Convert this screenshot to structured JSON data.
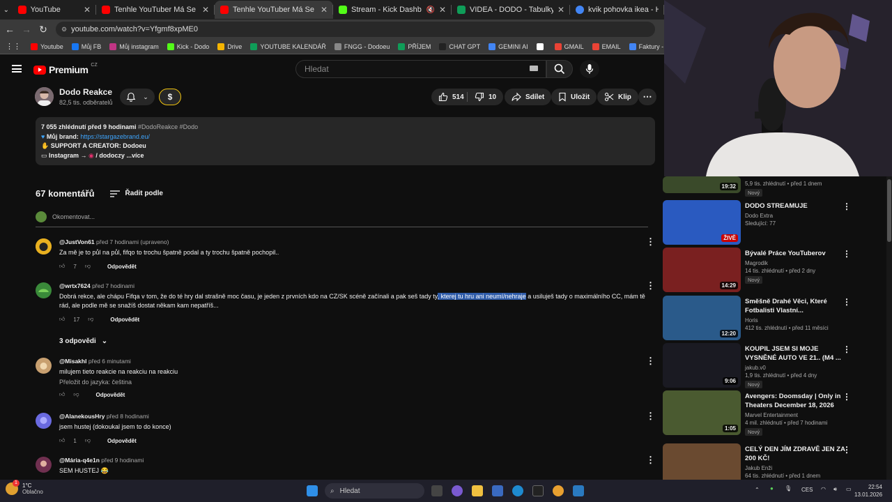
{
  "browser": {
    "tabs": [
      {
        "title": "YouTube",
        "color": "#ff0000",
        "active": false,
        "muted": false
      },
      {
        "title": "Tenhle YouTuber Má Se Mnou P...",
        "color": "#ff0000",
        "active": false,
        "muted": false
      },
      {
        "title": "Tenhle YouTuber Má Se Mnou P...",
        "color": "#ff0000",
        "active": true,
        "muted": false
      },
      {
        "title": "Stream - Kick Dashboard",
        "color": "#53fc18",
        "active": false,
        "muted": true
      },
      {
        "title": "VIDEA - DODO - Tabulky Google",
        "color": "#0f9d58",
        "active": false,
        "muted": false
      },
      {
        "title": "kvik pohovka ikea - Hledat Goog",
        "color": "#4285f4",
        "active": false,
        "muted": false
      }
    ],
    "url": "youtube.com/watch?v=Yfgmf8xpME0",
    "bookmarks": [
      {
        "label": "Youtube",
        "color": "#ff0000"
      },
      {
        "label": "Můj FB",
        "color": "#1877f2"
      },
      {
        "label": "Můj instagram",
        "color": "#c13584"
      },
      {
        "label": "Kick - Dodo",
        "color": "#53fc18"
      },
      {
        "label": "Drive",
        "color": "#f4b400"
      },
      {
        "label": "YOUTUBE KALENDÁŘ",
        "color": "#0f9d58"
      },
      {
        "label": "FNGG - Dodoeu",
        "color": "#888888"
      },
      {
        "label": "PŘÍJEM",
        "color": "#0f9d58"
      },
      {
        "label": "CHAT GPT",
        "color": "#222222"
      },
      {
        "label": "GEMINI AI",
        "color": "#4285f4"
      },
      {
        "label": "",
        "color": "#ffffff"
      },
      {
        "label": "GMAIL",
        "color": "#ea4335"
      },
      {
        "label": "EMAIL",
        "color": "#ea4335"
      },
      {
        "label": "Faktury - Vytváření",
        "color": "#4285f4"
      },
      {
        "label": "PNG to PDF",
        "color": "#e53935"
      }
    ]
  },
  "yt": {
    "logo": "Premium",
    "logo_region": "CZ",
    "search_placeholder": "Hledat"
  },
  "video": {
    "channel": "Dodo Reakce",
    "subs": "82,5 tis. odběratelů",
    "likes": "514",
    "dislikes": "10",
    "share": "Sdílet",
    "save": "Uložit",
    "clip": "Klip",
    "desc_meta": "7 055 zhlédnutí  před 9 hodinami",
    "desc_tags": "#DodoReakce #Dodo",
    "brand_label": "Můj brand: ",
    "brand_link": "https://stargazebrand.eu/",
    "support": "SUPPORT A CREATOR: Dodoeu",
    "insta": "Instagram → ",
    "insta_handle": " / dodoczy",
    "more": "...více"
  },
  "comments_section": {
    "count": "67 komentářů",
    "sort": "Řadit podle",
    "add_placeholder": "Okomentovat..."
  },
  "comments": [
    {
      "user": "@JustVon61",
      "time": "před 7 hodinami (upraveno)",
      "text": "Za mě je to půl na půl, fifqo to trochu špatně podal a ty trochu špatně pochopil..",
      "likes": "7",
      "reply": "Odpovědět",
      "color": "#e8b020"
    },
    {
      "user": "@wrtx7624",
      "time": "před 7 hodinami",
      "text_a": "Dobrá rekce, ale chápu Fifqa v tom, že do té hry dal strašně moc času, je jeden z prvních kdo na CZ/SK scéně začínali a pak seš tady ty",
      "text_hl": ", kterej tu hru ani neumí/nehraje",
      "text_b": " a usiluješ tady o maximálního CC, mám tě rád, ale podle mě se snažíš dostat někam kam nepatříš...",
      "likes": "17",
      "reply": "Odpovědět",
      "color": "#3a8a3a"
    },
    {
      "user": "@Misakhl",
      "time": "před 6 minutami",
      "text": "milujem tieto reakcie na reakciu na reakciu",
      "translate": "Přeložit do jazyka: čeština",
      "reply": "Odpovědět",
      "color": "#c8a070"
    },
    {
      "user": "@AlanekousHry",
      "time": "před 8 hodinami",
      "text": "jsem hustej (dokoukal jsem to do konce)",
      "likes": "1",
      "reply": "Odpovědět",
      "color": "#6a6ae0"
    },
    {
      "user": "@Mária-q4e1n",
      "time": "před 9 hodinami",
      "text": "SEM HUSTEJ 😂",
      "color": "#703050"
    }
  ],
  "replies_toggle": "3 odpovědi",
  "sidebar": [
    {
      "title": "",
      "channel": "",
      "stats": "5,9 tis. zhlédnutí • před 1 dnem",
      "badge": "Nový",
      "duration": "19:32",
      "thumb": "#3a4a2a"
    },
    {
      "title": "DODO STREAMUJE",
      "channel": "Dodo Extra",
      "stats": "Sledující: 77",
      "badge": "",
      "live": "ŽIVĚ",
      "thumb": "#2a5ac0"
    },
    {
      "title": "Bývalé Práce YouTuberov",
      "channel": "Magrodik",
      "stats": "14 tis. zhlédnutí • před 2 dny",
      "badge": "Nový",
      "duration": "14:29",
      "thumb": "#7a2020"
    },
    {
      "title": "Směšně Drahé Věci, Které Fotbalisti Vlastní...",
      "channel": "Horis",
      "stats": "412 tis. zhlédnutí • před 11 měsíci",
      "badge": "",
      "duration": "12:20",
      "thumb": "#2a5a8a"
    },
    {
      "title": "KOUPIL JSEM SI MOJE VYSNĚNÉ AUTO VE 21.. (M4 ...",
      "channel": "jakub.v0",
      "stats": "1,9 tis. zhlédnutí • před 4 dny",
      "badge": "Nový",
      "duration": "9:06",
      "thumb": "#1a1a22"
    },
    {
      "title": "Avengers: Doomsday | Only in Theaters December 18, 2026",
      "channel": "Marvel Entertainment",
      "stats": "4 mil. zhlédnutí • před 7 hodinami",
      "badge": "Nový",
      "duration": "1:05",
      "thumb": "#4a5a30"
    },
    {
      "title": "CELÝ DEN JÍM ZDRAVĚ JEN ZA 200 KČ!",
      "channel": "Jakub Enži",
      "stats": "64 tis. zhlédnutí • před 1 dnem",
      "badge": "",
      "duration": "",
      "thumb": "#6a4a30"
    }
  ],
  "taskbar": {
    "temp": "1°C",
    "weather": "Oblačno",
    "notif": "1",
    "search": "Hledat",
    "lang": "CES",
    "time": "22:54",
    "date": "13.01.2026"
  }
}
